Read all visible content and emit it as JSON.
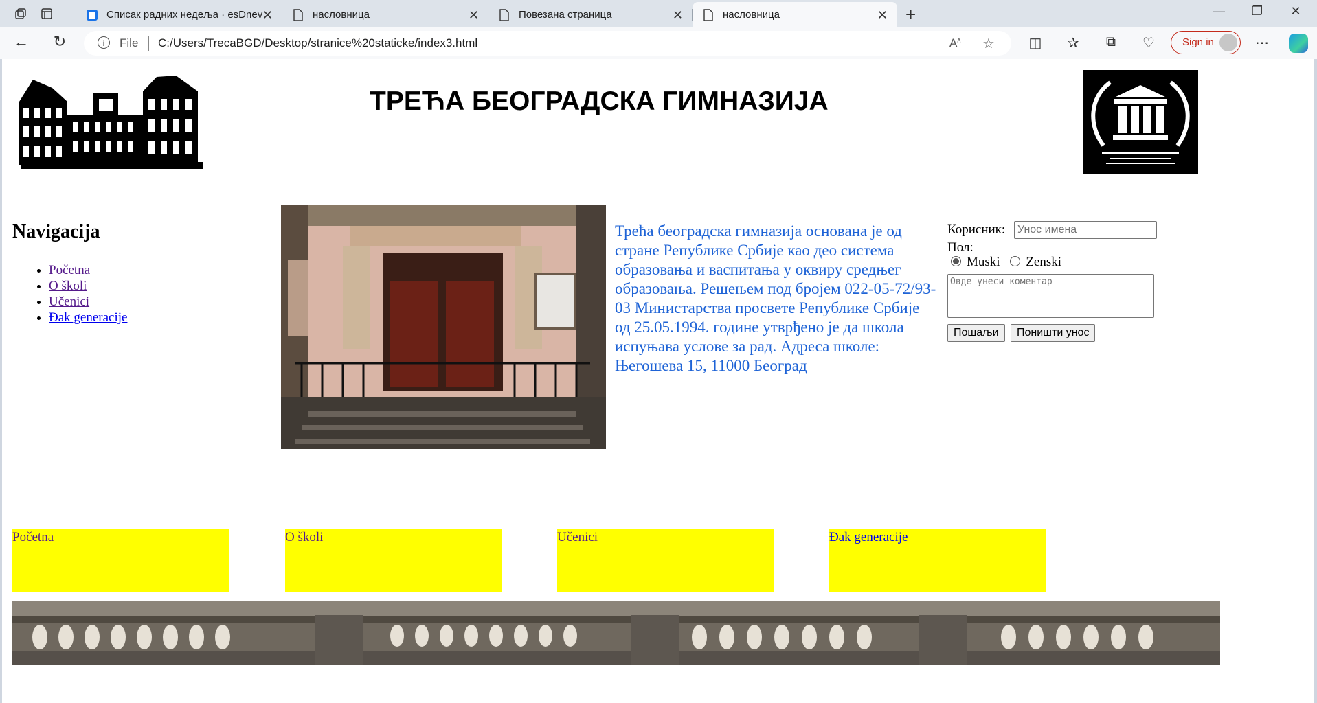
{
  "browser": {
    "tabs": [
      {
        "title": "Списак радних недеља · esDnev",
        "favicon": "esdnevnik-icon"
      },
      {
        "title": "насловница",
        "favicon": "page-icon"
      },
      {
        "title": "Повезана страница",
        "favicon": "page-icon"
      },
      {
        "title": "насловница",
        "favicon": "page-icon",
        "active": true
      }
    ],
    "address_scheme": "File",
    "url": "C:/Users/TrecaBGD/Desktop/stranice%20staticke/index3.html",
    "signin_label": "Sign in"
  },
  "page": {
    "title": "ТРЕЋА БЕОГРАДСКА ГИМНАЗИЈА",
    "nav_heading": "Navigacija",
    "nav_links": [
      "Početna",
      "O školi",
      "Učenici",
      "Đak generacije"
    ],
    "description": "Трећа београдска гимназија основана је од стране Републике Србије као део система образовања и васпитања у оквиру средњег образовања. Решењем под бројем 022-05-72/93-03 Министарства просвете Републике Србије од 25.05.1994. године утврђено је да школа испуњава услове за рад. Адреса школе: Његошева 15, 11000 Београд",
    "description_color": "#1e63d6",
    "form": {
      "user_label": "Корисник:",
      "user_placeholder": "Унос имена",
      "gender_label": "Пол:",
      "gender_options": [
        "Muski",
        "Zenski"
      ],
      "gender_selected": "Muski",
      "comment_placeholder": "Овде унеси коментар",
      "submit_label": "Пошаљи",
      "reset_label": "Поништи унос"
    },
    "bottom_links": [
      "Početna",
      "O školi",
      "Učenici",
      "Đak generacije"
    ],
    "bottom_box_color": "#ffff00"
  }
}
